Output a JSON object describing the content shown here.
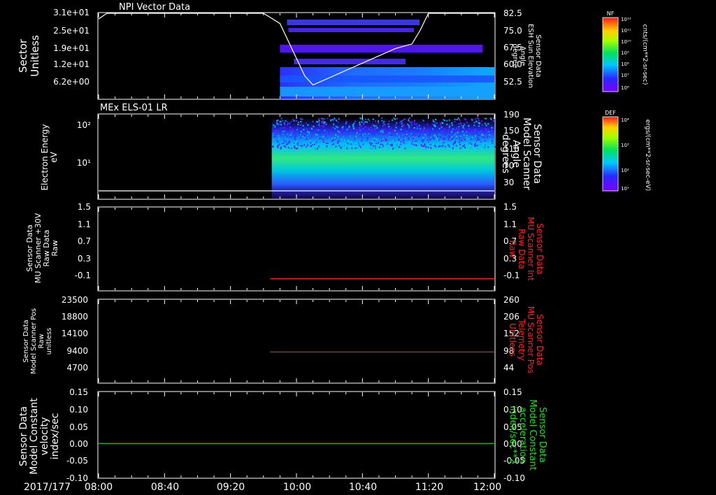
{
  "date_label": "2017/177",
  "x_ticks": [
    "08:00",
    "08:40",
    "09:20",
    "10:00",
    "10:40",
    "11:20",
    "12:00"
  ],
  "colors": {
    "white": "#ffffff",
    "red": "#ff2020",
    "green": "#22dd22"
  },
  "panels": [
    {
      "title": "NPI Vector Data",
      "left_label": [
        "Sector",
        "Unitless"
      ],
      "left_ticks": [
        "3.1e+01",
        "2.5e+01",
        "1.9e+01",
        "1.2e+01",
        "6.2e+00"
      ],
      "right_label": [
        "Sensor Data",
        "ESH Sun Elevation",
        "Angle",
        "degree"
      ],
      "right_ticks": [
        "82.5",
        "75.0",
        "67.5",
        "60.0",
        "52.5"
      ],
      "right_color": "#ffffff"
    },
    {
      "title": "MEx ELS-01 LR",
      "left_label": [
        "Electron Energy",
        "eV"
      ],
      "left_ticks": [
        "10²",
        "10¹"
      ],
      "right_label": [
        "Sensor Data",
        "Model Scanner",
        "Angle",
        "degrees"
      ],
      "right_ticks": [
        "190",
        "150",
        "110",
        "70",
        "30"
      ],
      "right_color": "#ffffff"
    },
    {
      "title": "",
      "left_label": [
        "Sensor Data",
        "MU Scanner +30V",
        "Raw Data",
        "Raw"
      ],
      "left_ticks": [
        "1.5",
        "1.1",
        "0.7",
        "0.3",
        "-0.1"
      ],
      "right_label": [
        "Sensor Data",
        "MU Scanner Int",
        "Raw Data",
        "Raw"
      ],
      "right_ticks": [
        "1.5",
        "1.1",
        "0.7",
        "0.3",
        "-0.1"
      ],
      "right_color": "#ff2020"
    },
    {
      "title": "",
      "left_label": [
        "Sensor Data",
        "Model Scanner Pos",
        "Raw",
        "unitless"
      ],
      "left_ticks": [
        "23500",
        "18800",
        "14100",
        "9400",
        "4700"
      ],
      "right_label": [
        "Sensor Data",
        "MU Scanner Pos",
        "Telemetry",
        "Unitless"
      ],
      "right_ticks": [
        "260",
        "206",
        "152",
        "98",
        "44"
      ],
      "right_color": "#ff2020"
    },
    {
      "title": "",
      "left_label": [
        "Sensor Data",
        "Model Constant",
        "velocity",
        "index/sec"
      ],
      "left_ticks": [
        "0.15",
        "0.10",
        "0.05",
        "0.00",
        "-0.05",
        "-0.10"
      ],
      "right_label": [
        "Sensor Data",
        "Model Constant",
        "acceleration",
        "index/sec**2"
      ],
      "right_ticks": [
        "0.15",
        "0.10",
        "0.05",
        "0.00",
        "-0.05",
        "-0.10"
      ],
      "right_color": "#22dd22"
    }
  ],
  "colorbars": [
    {
      "tag": "NF",
      "unit": "cnts/(cm**2-sr-sec)",
      "ticks": [
        "10¹²",
        "10¹¹",
        "10¹⁰",
        "10⁹",
        "10⁸",
        "10⁷",
        "10⁶"
      ]
    },
    {
      "tag": "DEF",
      "unit": "ergs/(cm**2-sr-sec-eV)",
      "ticks": [
        "10⁴",
        "10³",
        "10²",
        "10¹"
      ]
    }
  ],
  "chart_data": [
    {
      "type": "heatmap",
      "title": "NPI Vector Data",
      "ylabel": "Sector Unitless",
      "y2label": "Sensor Data ESH Sun Elevation Angle degree",
      "xlim": [
        "08:00",
        "12:00"
      ],
      "y2lim": [
        45,
        82.5
      ],
      "data_start": "09:50",
      "overlay_line": {
        "name": "ESH Sun Elevation Angle",
        "x": [
          "08:00",
          "08:05",
          "09:40",
          "09:50",
          "10:05",
          "10:10",
          "11:00",
          "11:10",
          "11:15",
          "11:20",
          "12:00"
        ],
        "y": [
          80,
          82.5,
          82.5,
          78,
          55,
          51,
          67,
          69,
          75,
          82.5,
          82.5
        ]
      }
    },
    {
      "type": "heatmap",
      "title": "MEx ELS-01 LR",
      "ylabel": "Electron Energy eV",
      "yscale": "log",
      "y2label": "Sensor Data Model Scanner Angle degrees",
      "y2lim": [
        0,
        190
      ],
      "data_start": "09:45",
      "overlay_line": {
        "name": "Model Scanner Angle",
        "x": [
          "08:00",
          "12:00"
        ],
        "y": [
          10,
          10
        ]
      }
    },
    {
      "type": "line",
      "ylim": [
        -0.3,
        1.5
      ],
      "series": [
        {
          "x": [
            "09:44",
            "12:00"
          ],
          "y": [
            -0.05,
            -0.05
          ]
        }
      ]
    },
    {
      "type": "line",
      "ylim": [
        0,
        23500
      ],
      "y2lim": [
        0,
        260
      ],
      "series": [
        {
          "x": [
            "09:44",
            "12:00"
          ],
          "y": [
            96,
            96
          ]
        }
      ]
    },
    {
      "type": "line",
      "ylim": [
        -0.1,
        0.15
      ],
      "series": [
        {
          "x": [
            "08:00",
            "12:00"
          ],
          "y": [
            0.0,
            0.0
          ]
        }
      ]
    }
  ]
}
